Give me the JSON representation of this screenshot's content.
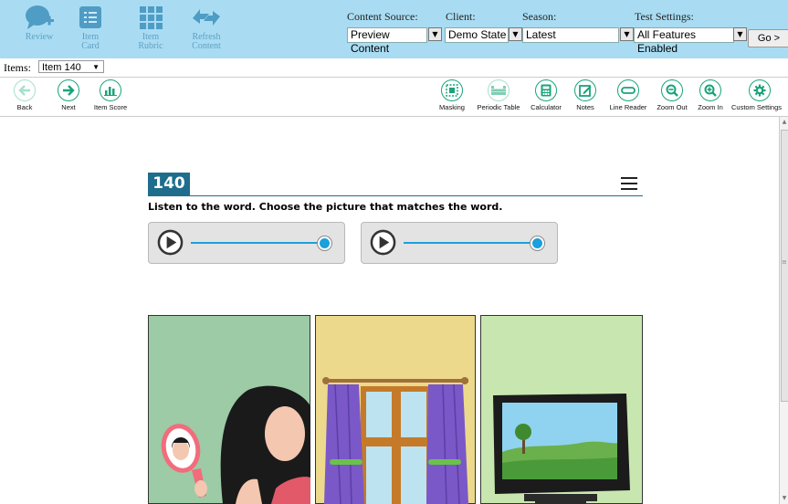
{
  "topbar": {
    "buttons": [
      {
        "label": "Review",
        "icon": "review-icon"
      },
      {
        "label": "Item Card",
        "icon": "item-card-icon"
      },
      {
        "label": "Item Rubric",
        "icon": "item-rubric-icon"
      },
      {
        "label": "Refresh Content",
        "icon": "refresh-content-icon"
      }
    ],
    "content_source": {
      "label": "Content Source:",
      "value": "Preview Content"
    },
    "client": {
      "label": "Client:",
      "value": "Demo State"
    },
    "season": {
      "label": "Season:",
      "value": "Latest"
    },
    "test_settings": {
      "label": "Test Settings:",
      "value": "All Features Enabled"
    },
    "go_label": "Go >"
  },
  "items": {
    "label": "Items:",
    "value": "Item 140"
  },
  "toolbar": {
    "left": [
      {
        "label": "Back",
        "icon": "back-arrow-icon"
      },
      {
        "label": "Next",
        "icon": "next-arrow-icon"
      },
      {
        "label": "Item Score",
        "icon": "bar-chart-icon"
      }
    ],
    "right": [
      {
        "label": "Masking",
        "icon": "masking-icon"
      },
      {
        "label": "Periodic Table",
        "icon": "periodic-table-icon"
      },
      {
        "label": "Calculator",
        "icon": "calculator-icon"
      },
      {
        "label": "Notes",
        "icon": "notes-icon"
      },
      {
        "label": "Line Reader",
        "icon": "line-reader-icon"
      },
      {
        "label": "Zoom Out",
        "icon": "zoom-out-icon"
      },
      {
        "label": "Zoom In",
        "icon": "zoom-in-icon"
      },
      {
        "label": "Custom Settings",
        "icon": "gear-icon"
      }
    ]
  },
  "question": {
    "number": "140",
    "prompt": "Listen to the word. Choose the picture that matches the word.",
    "audio_players": [
      {
        "progress": 1.0
      },
      {
        "progress": 1.0
      }
    ],
    "choices": [
      {
        "name": "girl-with-mirror",
        "bg": "#9ccba6"
      },
      {
        "name": "window-with-curtains",
        "bg": "#ecd98c"
      },
      {
        "name": "television",
        "bg": "#c8e7b0"
      }
    ]
  },
  "colors": {
    "topbar_bg": "#a9dcf3",
    "toolbar_accent": "#19a37a",
    "question_accent": "#1e6d8c",
    "audio_accent": "#1aa0db"
  }
}
